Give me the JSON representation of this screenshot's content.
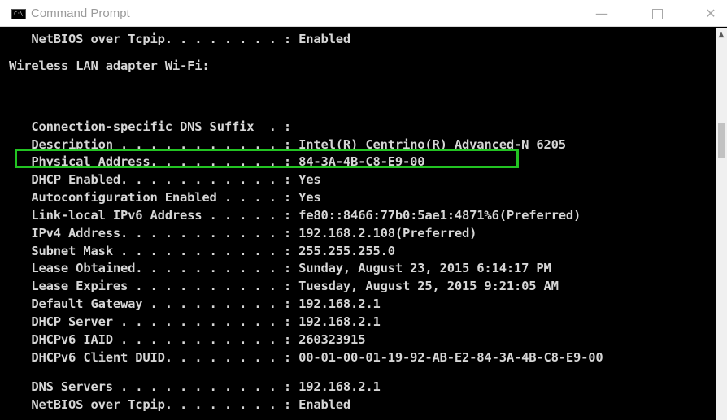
{
  "window": {
    "title": "Command Prompt",
    "app_icon_text": "C:\\",
    "minimize_glyph": "—",
    "close_glyph": "✕"
  },
  "console": {
    "lines": [
      "   NetBIOS over Tcpip. . . . . . . . : Enabled",
      "",
      "Wireless LAN adapter Wi-Fi:",
      "",
      "   Connection-specific DNS Suffix  . :",
      "   Description . . . . . . . . . . . : Intel(R) Centrino(R) Advanced-N 6205",
      "   Physical Address. . . . . . . . . : 84-3A-4B-C8-E9-00",
      "   DHCP Enabled. . . . . . . . . . . : Yes",
      "   Autoconfiguration Enabled . . . . : Yes",
      "   Link-local IPv6 Address . . . . . : fe80::8466:77b0:5ae1:4871%6(Preferred)",
      "   IPv4 Address. . . . . . . . . . . : 192.168.2.108(Preferred)",
      "   Subnet Mask . . . . . . . . . . . : 255.255.255.0",
      "   Lease Obtained. . . . . . . . . . : Sunday, August 23, 2015 6:14:17 PM",
      "   Lease Expires . . . . . . . . . . : Tuesday, August 25, 2015 9:21:05 AM",
      "   Default Gateway . . . . . . . . . : 192.168.2.1",
      "   DHCP Server . . . . . . . . . . . : 192.168.2.1",
      "   DHCPv6 IAID . . . . . . . . . . . : 260323915",
      "   DHCPv6 Client DUID. . . . . . . . : 00-01-00-01-19-92-AB-E2-84-3A-4B-C8-E9-00",
      "",
      "   DNS Servers . . . . . . . . . . . : 192.168.2.1",
      "   NetBIOS over Tcpip. . . . . . . . : Enabled"
    ],
    "text_color": "#d6d6d6",
    "highlight_color": "#22c322"
  },
  "scrollbar": {
    "up_arrow": "▲"
  }
}
